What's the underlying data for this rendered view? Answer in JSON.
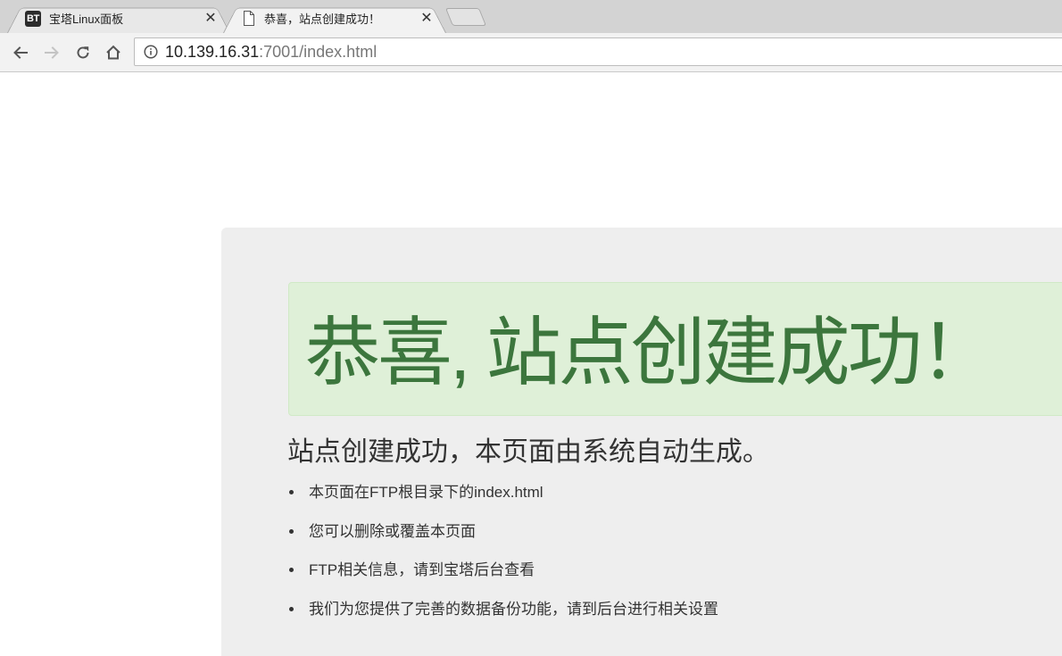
{
  "browser": {
    "tabs": [
      {
        "favicon": "bt-logo",
        "favicon_text": "BT",
        "title": "宝塔Linux面板",
        "close": "✕",
        "active": false
      },
      {
        "favicon": "document-icon",
        "title": "恭喜，站点创建成功！",
        "close": "✕",
        "active": true
      }
    ],
    "toolbar": {
      "back": "arrow-left-icon",
      "forward": "arrow-right-icon",
      "reload": "reload-icon",
      "home": "home-icon"
    },
    "address_bar": {
      "host": "10.139.16.31",
      "rest": ":7001/index.html"
    }
  },
  "page": {
    "alert_heading": "恭喜, 站点创建成功！",
    "subtitle": "站点创建成功，本页面由系统自动生成。",
    "list": [
      "本页面在FTP根目录下的index.html",
      "您可以删除或覆盖本页面",
      "FTP相关信息，请到宝塔后台查看",
      "我们为您提供了完善的数据备份功能，请到后台进行相关设置"
    ]
  },
  "colors": {
    "tab_strip": "#d3d3d3",
    "toolbar": "#f2f2f2",
    "alert_bg": "#dff0d8",
    "alert_text": "#3c763d",
    "container_bg": "#eeeeee"
  }
}
